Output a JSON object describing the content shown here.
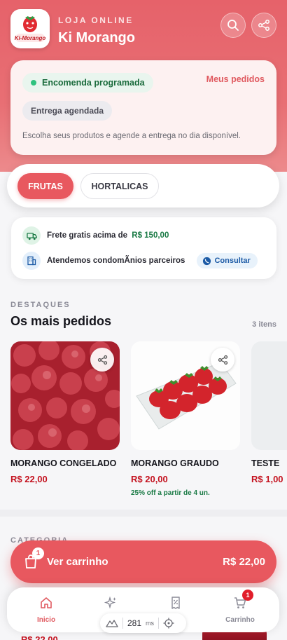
{
  "header": {
    "kicker": "LOJA ONLINE",
    "store_name": "Ki Morango",
    "logo_text": "Ki-Morango",
    "search_icon": "search-icon",
    "share_icon": "share-icon"
  },
  "order": {
    "status": "Encomenda programada",
    "my_orders": "Meus pedidos",
    "delivery": "Entrega agendada",
    "description": "Escolha seus produtos e agende a entrega no dia disponível."
  },
  "tabs": [
    {
      "label": "FRUTAS",
      "active": true
    },
    {
      "label": "HORTALICAS",
      "active": false
    }
  ],
  "info": {
    "shipping_text": "Frete gratis acima de",
    "shipping_value": "R$ 150,00",
    "condo_text": "Atendemos condomÃnios parceiros",
    "consult_label": "Consultar"
  },
  "featured": {
    "kicker": "DESTAQUES",
    "title": "Os mais pedidos",
    "count": "3 itens",
    "products": [
      {
        "name": "MORANGO CONGELADO",
        "price": "R$ 22,00",
        "promo": ""
      },
      {
        "name": "MORANGO GRAUDO",
        "price": "R$ 20,00",
        "promo": "25% off a partir de 4 un."
      },
      {
        "name": "TESTE",
        "price": "R$ 1,00",
        "promo": ""
      }
    ]
  },
  "category": {
    "kicker": "CATEGORIA"
  },
  "cart": {
    "badge": "1",
    "label": "Ver carrinho",
    "total": "R$ 22,00"
  },
  "peek": {
    "price": "R$ 22,00"
  },
  "nav": {
    "items": [
      {
        "label": "Inicio",
        "icon": "home-icon",
        "active": true
      },
      {
        "label": "Fi",
        "icon": "sparkles-icon",
        "active": false
      },
      {
        "label": "s",
        "icon": "discount-receipt-icon",
        "active": false
      },
      {
        "label": "Carrinho",
        "icon": "cart-icon",
        "active": false,
        "badge": "1"
      }
    ]
  },
  "perf": {
    "value": "281",
    "unit": "ms"
  },
  "colors": {
    "accent": "#e8585f",
    "price": "#c4121f",
    "success": "#1a7a45"
  }
}
